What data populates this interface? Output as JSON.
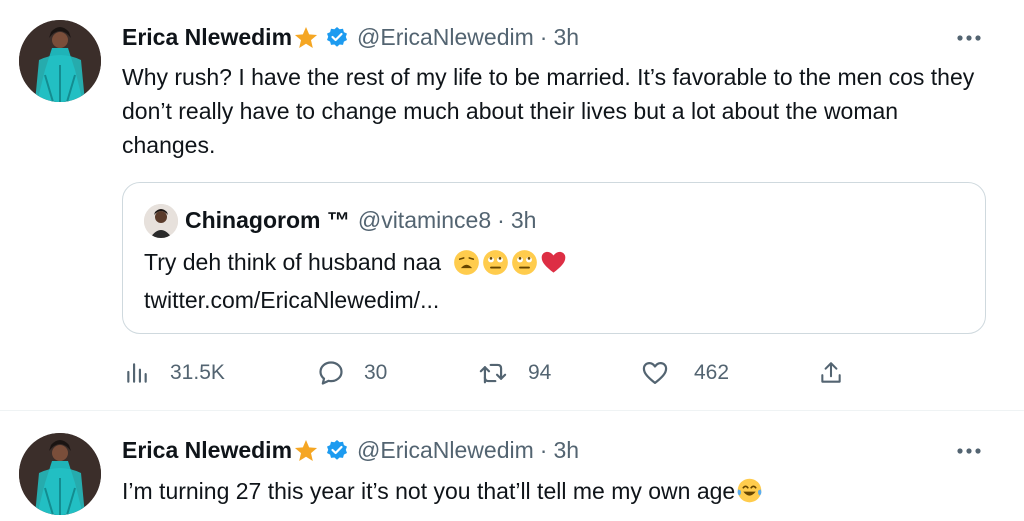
{
  "tweets": [
    {
      "name": "Erica Nlewedim",
      "handle": "@EricaNlewedim",
      "time": "3h",
      "text": "Why rush? I have the rest of my life to be married. It’s favorable to the men cos they don’t really have to change much about their lives but a lot about the woman changes.",
      "quote": {
        "name": "Chinagorom ™",
        "handle": "@vitamince8",
        "time": "3h",
        "text": "Try deh think of husband naa",
        "link": "twitter.com/EricaNlewedim/..."
      },
      "stats": {
        "views": "31.5K",
        "replies": "30",
        "retweets": "94",
        "likes": "462"
      }
    },
    {
      "name": "Erica Nlewedim",
      "handle": "@EricaNlewedim",
      "time": "3h",
      "text": "I’m turning 27 this year it’s not you that’ll tell me my own age"
    }
  ],
  "ui": {
    "dot": "·",
    "icons": [
      "star-emoji",
      "verified-badge",
      "more-icon",
      "views-icon",
      "reply-icon",
      "retweet-icon",
      "like-icon",
      "share-icon"
    ],
    "colors": {
      "verified": "#1d9bf0",
      "muted": "#536471",
      "text": "#0f1419",
      "border": "#cfd9de"
    }
  }
}
